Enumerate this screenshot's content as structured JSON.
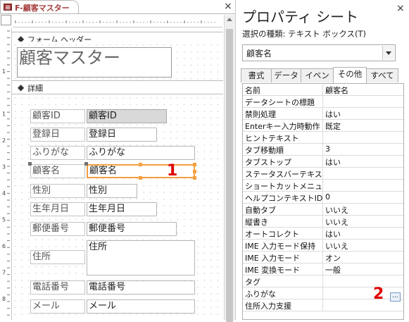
{
  "document_tab": {
    "title": "F-顧客マスター",
    "close": "×"
  },
  "ruler": {
    "top_marks": [
      "1",
      "2",
      "3",
      "4",
      "5",
      "6",
      "7",
      "8",
      "9",
      "10",
      "11",
      "12",
      "13",
      "14"
    ],
    "left_header_marks": [
      "1"
    ],
    "left_detail_marks": [
      "1",
      "2",
      "3",
      "4",
      "5",
      "6",
      "7",
      "8",
      "9"
    ]
  },
  "sections": {
    "form_header": "フォーム ヘッダー",
    "detail": "詳細",
    "chevron": "◆"
  },
  "form": {
    "title": "顧客マスター",
    "fields": [
      {
        "label": "顧客ID",
        "control": "顧客ID"
      },
      {
        "label": "登録日",
        "control": "登録日"
      },
      {
        "label": "ふりがな",
        "control": "ふりがな"
      },
      {
        "label": "顧客名",
        "control": "顧客名"
      },
      {
        "label": "性別",
        "control": "性別"
      },
      {
        "label": "生年月日",
        "control": "生年月日"
      },
      {
        "label": "郵便番号",
        "control": "郵便番号"
      },
      {
        "label": "住所",
        "control": "住所"
      },
      {
        "label": "電話番号",
        "control": "電話番号"
      },
      {
        "label": "メール",
        "control": "メール"
      }
    ]
  },
  "annotations": {
    "badge1": "1",
    "badge2": "2"
  },
  "property_sheet": {
    "title": "プロパティ シート",
    "close": "×",
    "selection_type": "選択の種類: テキスト ボックス(T)",
    "selected_object": "顧客名",
    "tabs": [
      "書式",
      "データ",
      "イベント",
      "その他",
      "すべて"
    ],
    "active_tab": "その他",
    "rows": [
      {
        "name": "名前",
        "value": "顧客名"
      },
      {
        "name": "データシートの標題",
        "value": ""
      },
      {
        "name": "禁則処理",
        "value": "はい"
      },
      {
        "name": "Enterキー入力時動作",
        "value": "既定"
      },
      {
        "name": "ヒントテキスト",
        "value": ""
      },
      {
        "name": "タブ移動順",
        "value": "3"
      },
      {
        "name": "タブストップ",
        "value": "はい"
      },
      {
        "name": "ステータスバーテキスト",
        "value": ""
      },
      {
        "name": "ショートカットメニューバー",
        "value": ""
      },
      {
        "name": "ヘルプコンテキストID",
        "value": "0"
      },
      {
        "name": "自動タブ",
        "value": "いいえ"
      },
      {
        "name": "縦書き",
        "value": "いいえ"
      },
      {
        "name": "オートコレクト",
        "value": "はい"
      },
      {
        "name": "IME 入力モード保持",
        "value": "いいえ"
      },
      {
        "name": "IME 入力モード",
        "value": "オン"
      },
      {
        "name": "IME 変換モード",
        "value": "一般"
      },
      {
        "name": "タグ",
        "value": ""
      },
      {
        "name": "ふりがな",
        "value": ""
      },
      {
        "name": "住所入力支援",
        "value": ""
      }
    ],
    "builder_button": "...",
    "colors": {
      "selection_orange": "#f2a040",
      "badge_red": "#e00000",
      "tab_red": "#a33a3a"
    }
  }
}
